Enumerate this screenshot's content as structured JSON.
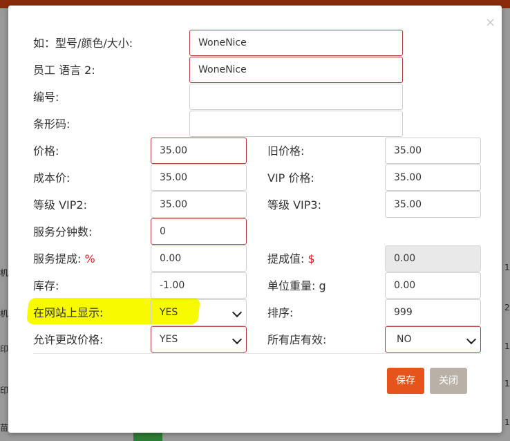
{
  "bg": {
    "left_cells": [
      "机",
      "机",
      "印",
      "印",
      "苗"
    ],
    "right_cells": [
      "1",
      "2",
      "1",
      "1",
      "1"
    ]
  },
  "modal": {
    "close_glyph": "×",
    "labels": {
      "spec": "如：型号/颜色/大小:",
      "staff_lang2": "员工 语言 2:",
      "code": "编号:",
      "barcode": "条形码:",
      "price": "价格:",
      "old_price": "旧价格:",
      "cost": "成本价:",
      "vip_price": "VIP 价格:",
      "vip2": "等级 VIP2:",
      "vip3": "等级 VIP3:",
      "service_minutes": "服务分钟数:",
      "commission": "服务提成:",
      "commission_unit": "%",
      "commission_value": "提成值:",
      "commission_value_unit": "$",
      "stock": "库存:",
      "unit_weight": "单位重量: g",
      "show_on_site": "在网站上显示:",
      "sort": "排序:",
      "allow_price_change": "允许更改价格:",
      "all_stores": "所有店有效:"
    },
    "fields": {
      "spec": "WoneNice",
      "staff_lang2": "WoneNice",
      "code": "",
      "barcode": "",
      "price": "35.00",
      "old_price": "35.00",
      "cost": "35.00",
      "vip_price": "35.00",
      "vip2": "35.00",
      "vip3": "35.00",
      "service_minutes": "0",
      "commission": "0.00",
      "commission_value": "0.00",
      "stock": "-1.00",
      "unit_weight": "0.00",
      "show_on_site": "YES",
      "sort": "999",
      "allow_price_change": "YES",
      "all_stores": "NO"
    },
    "buttons": {
      "save": "保存",
      "close": "关闭"
    }
  },
  "colors": {
    "primary_button": "#e4541b",
    "secondary_button": "#b9b0a8",
    "error_border": "#b53c3c",
    "highlight": "#f8fa00"
  }
}
